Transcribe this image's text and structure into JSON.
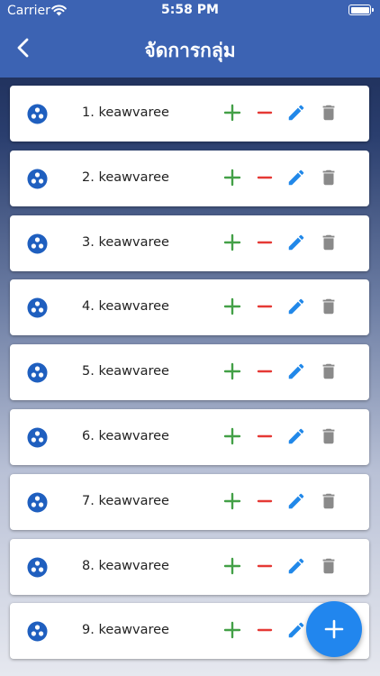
{
  "status_bar": {
    "carrier": "Carrier",
    "time": "5:58 PM"
  },
  "header": {
    "title": "จัดการกลุ่ม",
    "back_icon": "chevron-left-icon"
  },
  "groups": [
    {
      "label": "1. keawvaree"
    },
    {
      "label": "2. keawvaree"
    },
    {
      "label": "3. keawvaree"
    },
    {
      "label": "4. keawvaree"
    },
    {
      "label": "5. keawvaree"
    },
    {
      "label": "6. keawvaree"
    },
    {
      "label": "7. keawvaree"
    },
    {
      "label": "8. keawvaree"
    },
    {
      "label": "9. keawvaree"
    }
  ],
  "icons": {
    "group": "group-icon",
    "add": "plus-icon",
    "remove": "minus-icon",
    "edit": "pencil-icon",
    "delete": "trash-icon",
    "fab": "plus-icon"
  },
  "colors": {
    "header": "#3c63b3",
    "group_icon": "#1f5fbf",
    "add": "#43a047",
    "remove": "#e53935",
    "edit": "#2188e9",
    "delete": "#8a8a8a",
    "fab": "#2186ee"
  }
}
